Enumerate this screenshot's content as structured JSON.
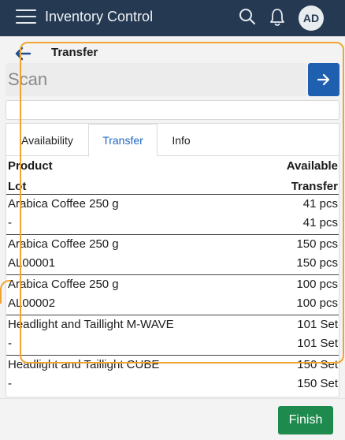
{
  "appbar": {
    "title": "Inventory Control",
    "avatar_initials": "AD",
    "icons": [
      "menu-icon",
      "search-icon",
      "bell-icon"
    ]
  },
  "header": {
    "title": "Transfer"
  },
  "scan": {
    "placeholder": "Scan"
  },
  "tabs": [
    {
      "label": "Availability",
      "active": false
    },
    {
      "label": "Transfer",
      "active": true
    },
    {
      "label": "Info",
      "active": false
    }
  ],
  "table": {
    "headers": {
      "col1_line1": "Product",
      "col1_line2": "Lot",
      "col2_line1": "Available",
      "col2_line2": "Transfer"
    },
    "rows": [
      {
        "product": "Arabica Coffee 250 g",
        "lot": "-",
        "available": "41 pcs",
        "transfer": "41 pcs"
      },
      {
        "product": "Arabica Coffee 250 g",
        "lot": "AL00001",
        "available": "150 pcs",
        "transfer": "150 pcs"
      },
      {
        "product": "Arabica Coffee 250 g",
        "lot": "AL00002",
        "available": "100 pcs",
        "transfer": "100 pcs"
      },
      {
        "product": "Headlight and Taillight M-WAVE",
        "lot": "-",
        "available": "101 Set",
        "transfer": "101 Set"
      },
      {
        "product": "Headlight and Taillight CUBE",
        "lot": "-",
        "available": "150 Set",
        "transfer": "150 Set"
      }
    ]
  },
  "footer": {
    "finish_label": "Finish"
  },
  "colors": {
    "appbar": "#253a52",
    "scan_button": "#1f5fb0",
    "active_tab": "#1f66c1",
    "finish_button": "#1f8a4d",
    "highlight": "#f0a530"
  }
}
